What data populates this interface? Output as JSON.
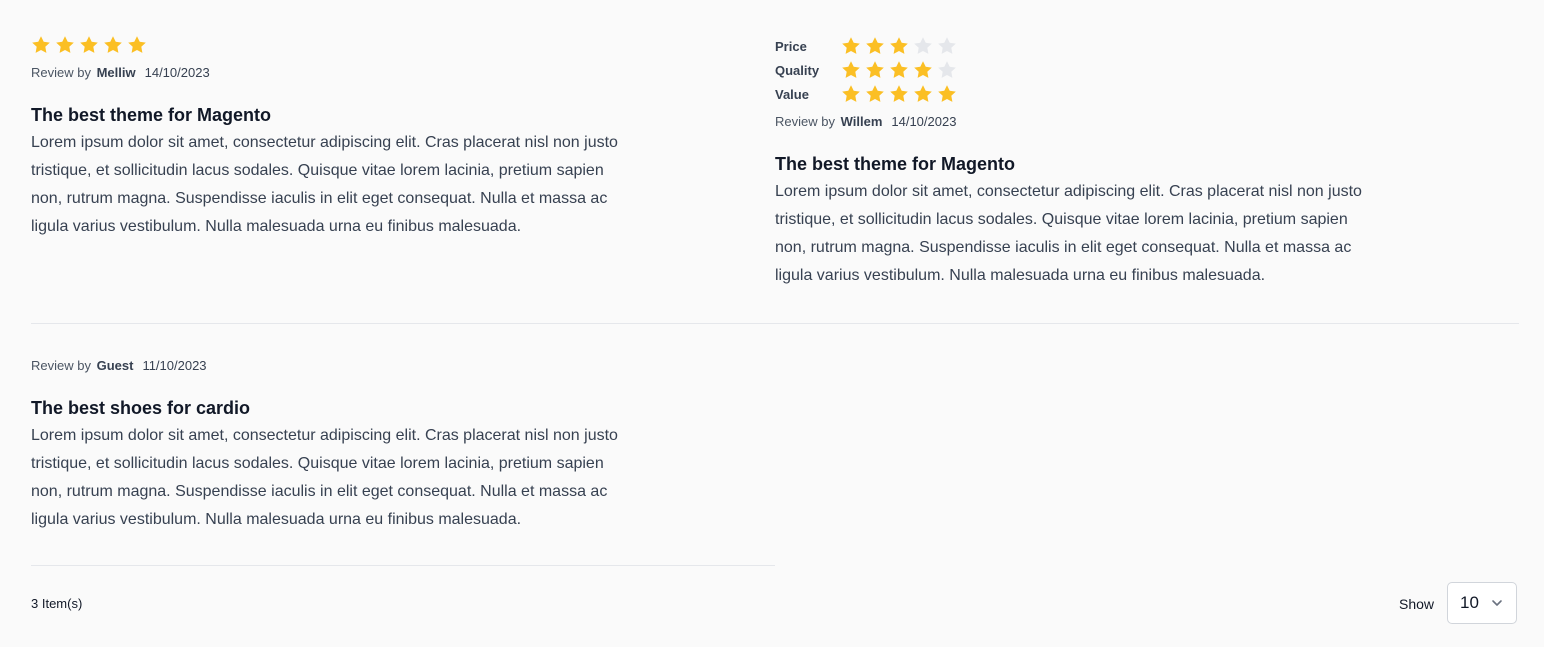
{
  "colors": {
    "star_filled": "#fbbf24",
    "star_empty": "#e5e7eb"
  },
  "reviews": [
    {
      "rating": 5,
      "review_by": "Review by",
      "author": "Melliw",
      "date": "14/10/2023",
      "title": "The best theme for Magento",
      "body": "Lorem ipsum dolor sit amet, consectetur adipiscing elit. Cras placerat nisl non justo tristique, et sollicitudin lacus sodales. Quisque vitae lorem lacinia, pretium sapien non, rutrum magna. Suspendisse iaculis in elit eget consequat. Nulla et massa ac ligula varius vestibulum. Nulla malesuada urna eu finibus malesuada."
    },
    {
      "ratings": [
        {
          "label": "Price",
          "value": 3
        },
        {
          "label": "Quality",
          "value": 4
        },
        {
          "label": "Value",
          "value": 5
        }
      ],
      "review_by": "Review by",
      "author": "Willem",
      "date": "14/10/2023",
      "title": "The best theme for Magento",
      "body": "Lorem ipsum dolor sit amet, consectetur adipiscing elit. Cras placerat nisl non justo tristique, et sollicitudin lacus sodales. Quisque vitae lorem lacinia, pretium sapien non, rutrum magna. Suspendisse iaculis in elit eget consequat. Nulla et massa ac ligula varius vestibulum. Nulla malesuada urna eu finibus malesuada."
    },
    {
      "review_by": "Review by",
      "author": "Guest",
      "date": "11/10/2023",
      "title": "The best shoes for cardio",
      "body": "Lorem ipsum dolor sit amet, consectetur adipiscing elit. Cras placerat nisl non justo tristique, et sollicitudin lacus sodales. Quisque vitae lorem lacinia, pretium sapien non, rutrum magna. Suspendisse iaculis in elit eget consequat. Nulla et massa ac ligula varius vestibulum. Nulla malesuada urna eu finibus malesuada."
    }
  ],
  "footer": {
    "count": "3 Item(s)",
    "show_label": "Show",
    "page_size": "10"
  }
}
